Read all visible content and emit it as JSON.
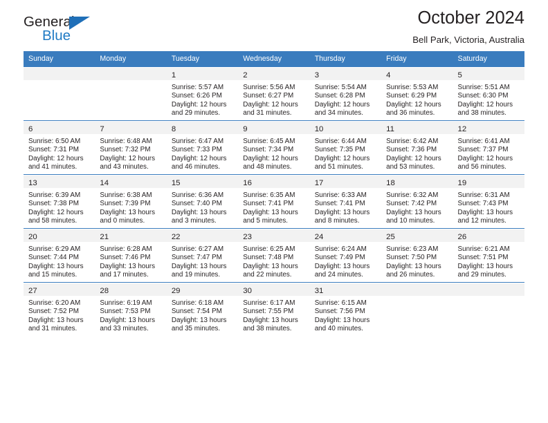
{
  "brand": {
    "name_part1": "General",
    "name_part2": "Blue",
    "triangle_color": "#1f6fb8",
    "blue_color": "#1f7ac4"
  },
  "header": {
    "title": "October 2024",
    "subtitle": "Bell Park, Victoria, Australia"
  },
  "theme": {
    "header_row_bg": "#3a7cbe",
    "daynum_band_bg": "#f2f2f2",
    "text_color": "#231f20",
    "cell_border": "#3a7cbe"
  },
  "weekday_headers": [
    "Sunday",
    "Monday",
    "Tuesday",
    "Wednesday",
    "Thursday",
    "Friday",
    "Saturday"
  ],
  "labels": {
    "sunrise_prefix": "Sunrise:",
    "sunset_prefix": "Sunset:",
    "daylight_prefix": "Daylight:"
  },
  "weeks": [
    [
      {
        "day": "",
        "empty": true,
        "l1": "",
        "l2": "",
        "l3": "",
        "l4": ""
      },
      {
        "day": "",
        "empty": true,
        "l1": "",
        "l2": "",
        "l3": "",
        "l4": ""
      },
      {
        "day": "1",
        "l1": "Sunrise: 5:57 AM",
        "l2": "Sunset: 6:26 PM",
        "l3": "Daylight: 12 hours",
        "l4": "and 29 minutes."
      },
      {
        "day": "2",
        "l1": "Sunrise: 5:56 AM",
        "l2": "Sunset: 6:27 PM",
        "l3": "Daylight: 12 hours",
        "l4": "and 31 minutes."
      },
      {
        "day": "3",
        "l1": "Sunrise: 5:54 AM",
        "l2": "Sunset: 6:28 PM",
        "l3": "Daylight: 12 hours",
        "l4": "and 34 minutes."
      },
      {
        "day": "4",
        "l1": "Sunrise: 5:53 AM",
        "l2": "Sunset: 6:29 PM",
        "l3": "Daylight: 12 hours",
        "l4": "and 36 minutes."
      },
      {
        "day": "5",
        "l1": "Sunrise: 5:51 AM",
        "l2": "Sunset: 6:30 PM",
        "l3": "Daylight: 12 hours",
        "l4": "and 38 minutes."
      }
    ],
    [
      {
        "day": "6",
        "l1": "Sunrise: 6:50 AM",
        "l2": "Sunset: 7:31 PM",
        "l3": "Daylight: 12 hours",
        "l4": "and 41 minutes."
      },
      {
        "day": "7",
        "l1": "Sunrise: 6:48 AM",
        "l2": "Sunset: 7:32 PM",
        "l3": "Daylight: 12 hours",
        "l4": "and 43 minutes."
      },
      {
        "day": "8",
        "l1": "Sunrise: 6:47 AM",
        "l2": "Sunset: 7:33 PM",
        "l3": "Daylight: 12 hours",
        "l4": "and 46 minutes."
      },
      {
        "day": "9",
        "l1": "Sunrise: 6:45 AM",
        "l2": "Sunset: 7:34 PM",
        "l3": "Daylight: 12 hours",
        "l4": "and 48 minutes."
      },
      {
        "day": "10",
        "l1": "Sunrise: 6:44 AM",
        "l2": "Sunset: 7:35 PM",
        "l3": "Daylight: 12 hours",
        "l4": "and 51 minutes."
      },
      {
        "day": "11",
        "l1": "Sunrise: 6:42 AM",
        "l2": "Sunset: 7:36 PM",
        "l3": "Daylight: 12 hours",
        "l4": "and 53 minutes."
      },
      {
        "day": "12",
        "l1": "Sunrise: 6:41 AM",
        "l2": "Sunset: 7:37 PM",
        "l3": "Daylight: 12 hours",
        "l4": "and 56 minutes."
      }
    ],
    [
      {
        "day": "13",
        "l1": "Sunrise: 6:39 AM",
        "l2": "Sunset: 7:38 PM",
        "l3": "Daylight: 12 hours",
        "l4": "and 58 minutes."
      },
      {
        "day": "14",
        "l1": "Sunrise: 6:38 AM",
        "l2": "Sunset: 7:39 PM",
        "l3": "Daylight: 13 hours",
        "l4": "and 0 minutes."
      },
      {
        "day": "15",
        "l1": "Sunrise: 6:36 AM",
        "l2": "Sunset: 7:40 PM",
        "l3": "Daylight: 13 hours",
        "l4": "and 3 minutes."
      },
      {
        "day": "16",
        "l1": "Sunrise: 6:35 AM",
        "l2": "Sunset: 7:41 PM",
        "l3": "Daylight: 13 hours",
        "l4": "and 5 minutes."
      },
      {
        "day": "17",
        "l1": "Sunrise: 6:33 AM",
        "l2": "Sunset: 7:41 PM",
        "l3": "Daylight: 13 hours",
        "l4": "and 8 minutes."
      },
      {
        "day": "18",
        "l1": "Sunrise: 6:32 AM",
        "l2": "Sunset: 7:42 PM",
        "l3": "Daylight: 13 hours",
        "l4": "and 10 minutes."
      },
      {
        "day": "19",
        "l1": "Sunrise: 6:31 AM",
        "l2": "Sunset: 7:43 PM",
        "l3": "Daylight: 13 hours",
        "l4": "and 12 minutes."
      }
    ],
    [
      {
        "day": "20",
        "l1": "Sunrise: 6:29 AM",
        "l2": "Sunset: 7:44 PM",
        "l3": "Daylight: 13 hours",
        "l4": "and 15 minutes."
      },
      {
        "day": "21",
        "l1": "Sunrise: 6:28 AM",
        "l2": "Sunset: 7:46 PM",
        "l3": "Daylight: 13 hours",
        "l4": "and 17 minutes."
      },
      {
        "day": "22",
        "l1": "Sunrise: 6:27 AM",
        "l2": "Sunset: 7:47 PM",
        "l3": "Daylight: 13 hours",
        "l4": "and 19 minutes."
      },
      {
        "day": "23",
        "l1": "Sunrise: 6:25 AM",
        "l2": "Sunset: 7:48 PM",
        "l3": "Daylight: 13 hours",
        "l4": "and 22 minutes."
      },
      {
        "day": "24",
        "l1": "Sunrise: 6:24 AM",
        "l2": "Sunset: 7:49 PM",
        "l3": "Daylight: 13 hours",
        "l4": "and 24 minutes."
      },
      {
        "day": "25",
        "l1": "Sunrise: 6:23 AM",
        "l2": "Sunset: 7:50 PM",
        "l3": "Daylight: 13 hours",
        "l4": "and 26 minutes."
      },
      {
        "day": "26",
        "l1": "Sunrise: 6:21 AM",
        "l2": "Sunset: 7:51 PM",
        "l3": "Daylight: 13 hours",
        "l4": "and 29 minutes."
      }
    ],
    [
      {
        "day": "27",
        "l1": "Sunrise: 6:20 AM",
        "l2": "Sunset: 7:52 PM",
        "l3": "Daylight: 13 hours",
        "l4": "and 31 minutes."
      },
      {
        "day": "28",
        "l1": "Sunrise: 6:19 AM",
        "l2": "Sunset: 7:53 PM",
        "l3": "Daylight: 13 hours",
        "l4": "and 33 minutes."
      },
      {
        "day": "29",
        "l1": "Sunrise: 6:18 AM",
        "l2": "Sunset: 7:54 PM",
        "l3": "Daylight: 13 hours",
        "l4": "and 35 minutes."
      },
      {
        "day": "30",
        "l1": "Sunrise: 6:17 AM",
        "l2": "Sunset: 7:55 PM",
        "l3": "Daylight: 13 hours",
        "l4": "and 38 minutes."
      },
      {
        "day": "31",
        "l1": "Sunrise: 6:15 AM",
        "l2": "Sunset: 7:56 PM",
        "l3": "Daylight: 13 hours",
        "l4": "and 40 minutes."
      },
      {
        "day": "",
        "empty": true,
        "l1": "",
        "l2": "",
        "l3": "",
        "l4": ""
      },
      {
        "day": "",
        "empty": true,
        "l1": "",
        "l2": "",
        "l3": "",
        "l4": ""
      }
    ]
  ]
}
